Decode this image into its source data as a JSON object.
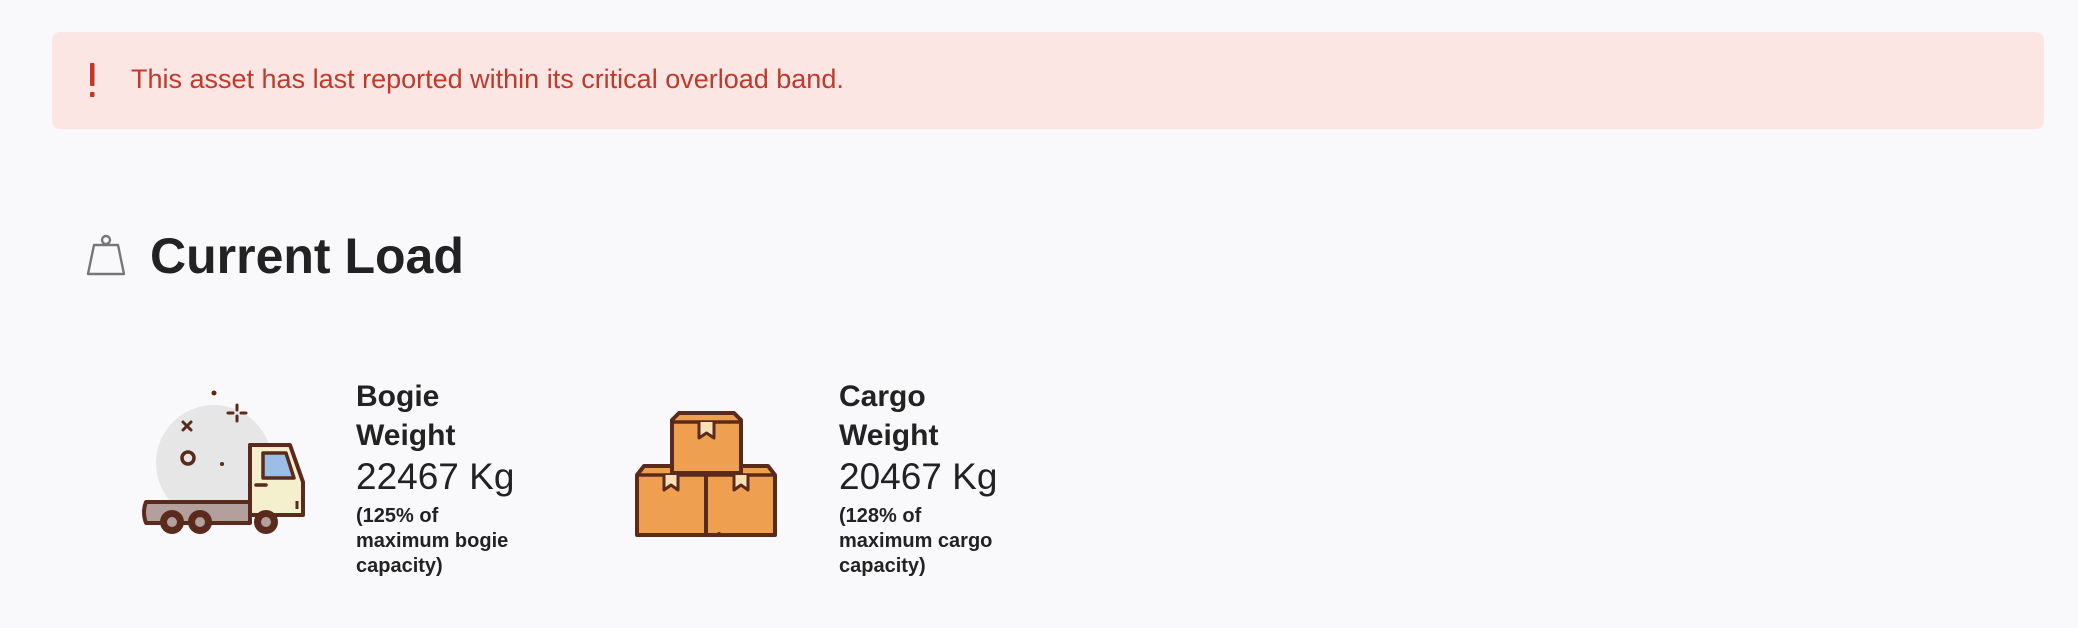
{
  "alert": {
    "message": "This asset has last reported within its critical overload band.",
    "icon": "exclamation-icon",
    "color": "#c0392b",
    "background": "#fbe6e3"
  },
  "section": {
    "title": "Current Load",
    "icon": "weight-icon"
  },
  "cards": [
    {
      "label": "Bogie Weight",
      "value": "22467 Kg",
      "note": "(125% of maximum bogie capacity)",
      "illustration": "truck-illustration"
    },
    {
      "label": "Cargo Weight",
      "value": "20467 Kg",
      "note": "(128% of maximum cargo capacity)",
      "illustration": "boxes-illustration"
    }
  ]
}
